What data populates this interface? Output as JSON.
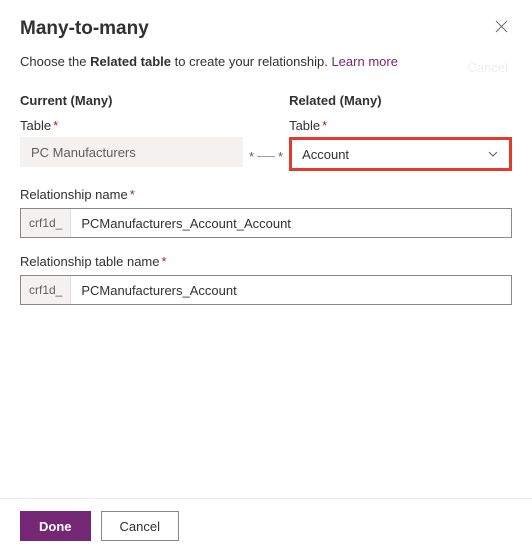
{
  "header": {
    "title": "Many-to-many"
  },
  "intro": {
    "prefix": "Choose the ",
    "bold": "Related table",
    "suffix": " to create your relationship. ",
    "link": "Learn more"
  },
  "ghost": "Cancel",
  "columns": {
    "current": {
      "heading": "Current (Many)",
      "tableLabel": "Table",
      "tableValue": "PC Manufacturers"
    },
    "connector": {
      "leftStar": "*",
      "rightStar": "*"
    },
    "related": {
      "heading": "Related (Many)",
      "tableLabel": "Table",
      "tableValue": "Account"
    }
  },
  "relName": {
    "label": "Relationship name",
    "prefix": "crf1d_",
    "value": "PCManufacturers_Account_Account"
  },
  "relTableName": {
    "label": "Relationship table name",
    "prefix": "crf1d_",
    "value": "PCManufacturers_Account"
  },
  "footer": {
    "done": "Done",
    "cancel": "Cancel"
  }
}
